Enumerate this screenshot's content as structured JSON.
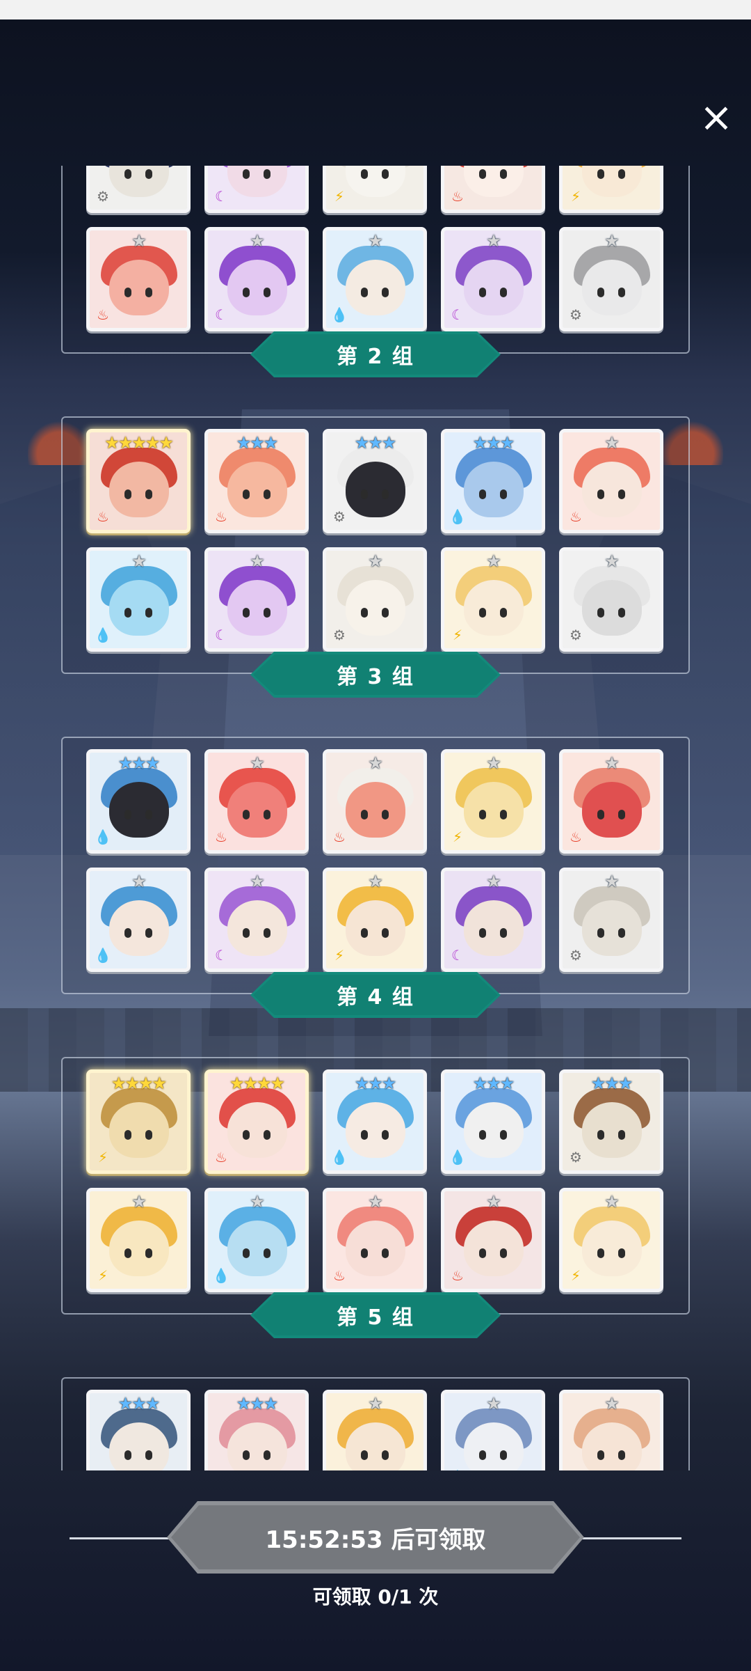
{
  "close_icon": "×",
  "groups": [
    {
      "label": "",
      "heroes": [
        {
          "stars": "★★★",
          "tier": "blue",
          "element": "neutral",
          "palette": [
            "#f0f0ee",
            "#2f3a66",
            "#e8e4dc"
          ]
        },
        {
          "stars": "★★★",
          "tier": "blue",
          "element": "shadow",
          "palette": [
            "#efe6f7",
            "#a35fd6",
            "#f1dbe7"
          ]
        },
        {
          "stars": "★★★",
          "tier": "blue",
          "element": "light",
          "palette": [
            "#f2efe8",
            "#e5e1d8",
            "#f6f4ef"
          ]
        },
        {
          "stars": "★★★",
          "tier": "blue",
          "element": "fire",
          "palette": [
            "#f6e8e2",
            "#d7463c",
            "#fbefe8"
          ]
        },
        {
          "stars": "★★★",
          "tier": "blue",
          "element": "light",
          "palette": [
            "#f8efdd",
            "#f0b341",
            "#f8e9d6"
          ]
        },
        {
          "stars": "★",
          "tier": "gray",
          "element": "fire",
          "palette": [
            "#f8e3e1",
            "#e1574e",
            "#f4b0a2"
          ]
        },
        {
          "stars": "★",
          "tier": "gray",
          "element": "shadow",
          "palette": [
            "#ede3f6",
            "#8f4fcf",
            "#e3c8f2"
          ]
        },
        {
          "stars": "★",
          "tier": "gray",
          "element": "water",
          "palette": [
            "#e2f0fb",
            "#6fb6e4",
            "#f4ebe2"
          ]
        },
        {
          "stars": "★",
          "tier": "gray",
          "element": "shadow",
          "palette": [
            "#ece3f6",
            "#8d58cc",
            "#e5d5f2"
          ]
        },
        {
          "stars": "★",
          "tier": "gray",
          "element": "neutral",
          "palette": [
            "#eeeeee",
            "#a7a7a9",
            "#e9e9ea"
          ]
        }
      ],
      "tag": "第 2 组"
    },
    {
      "heroes": [
        {
          "stars": "★★★★★",
          "tier": "gold",
          "element": "fire",
          "palette": [
            "#f6ded6",
            "#d14738",
            "#f2b8a3"
          ],
          "gold": true
        },
        {
          "stars": "★★★",
          "tier": "blue",
          "element": "fire",
          "palette": [
            "#fbe6de",
            "#ef8a6d",
            "#f6b89f"
          ]
        },
        {
          "stars": "★★★",
          "tier": "blue",
          "element": "neutral",
          "palette": [
            "#f1f1f1",
            "#ececec",
            "#2b2b32"
          ]
        },
        {
          "stars": "★★★",
          "tier": "blue",
          "element": "water",
          "palette": [
            "#e1eefc",
            "#5d97d9",
            "#a9c9ec"
          ]
        },
        {
          "stars": "★",
          "tier": "gray",
          "element": "fire",
          "palette": [
            "#fbe6e0",
            "#ee7b66",
            "#f7e6dc"
          ]
        },
        {
          "stars": "★",
          "tier": "gray",
          "element": "water",
          "palette": [
            "#e0f1fb",
            "#56aee0",
            "#a5dbf3"
          ]
        },
        {
          "stars": "★",
          "tier": "gray",
          "element": "shadow",
          "palette": [
            "#ede3f6",
            "#8f4fcf",
            "#e3c8f2"
          ]
        },
        {
          "stars": "★",
          "tier": "gray",
          "element": "neutral",
          "palette": [
            "#f2efea",
            "#e7e1d6",
            "#f7f2ea"
          ]
        },
        {
          "stars": "★",
          "tier": "gray",
          "element": "light",
          "palette": [
            "#fbf3df",
            "#f3ce7a",
            "#f8ebd8"
          ]
        },
        {
          "stars": "★",
          "tier": "gray",
          "element": "neutral",
          "palette": [
            "#f1f1f1",
            "#e6e6e6",
            "#dcdcdc"
          ]
        }
      ],
      "tag": "第 3 组"
    },
    {
      "heroes": [
        {
          "stars": "★★★",
          "tier": "blue",
          "element": "water",
          "palette": [
            "#e3eef8",
            "#4a8fce",
            "#2b2b32"
          ]
        },
        {
          "stars": "★",
          "tier": "gray",
          "element": "fire",
          "palette": [
            "#fbe1df",
            "#e8554e",
            "#f0807a"
          ]
        },
        {
          "stars": "★",
          "tier": "gray",
          "element": "fire",
          "palette": [
            "#f6ebe6",
            "#f2efea",
            "#f19784"
          ]
        },
        {
          "stars": "★",
          "tier": "gray",
          "element": "light",
          "palette": [
            "#fbf3dd",
            "#f0c75d",
            "#f6e1a8"
          ]
        },
        {
          "stars": "★",
          "tier": "gray",
          "element": "fire",
          "palette": [
            "#fbe6df",
            "#eb8a78",
            "#e05050"
          ]
        },
        {
          "stars": "★",
          "tier": "gray",
          "element": "water",
          "palette": [
            "#e5eff9",
            "#4e9bd6",
            "#f4e6dc"
          ]
        },
        {
          "stars": "★",
          "tier": "gray",
          "element": "shadow",
          "palette": [
            "#efe4f6",
            "#a66bd8",
            "#f4e6dc"
          ]
        },
        {
          "stars": "★",
          "tier": "gray",
          "element": "light",
          "palette": [
            "#fbf2dc",
            "#f2bd48",
            "#f6e5d4"
          ]
        },
        {
          "stars": "★",
          "tier": "gray",
          "element": "shadow",
          "palette": [
            "#ebe2f4",
            "#8a55c9",
            "#f1e3da"
          ]
        },
        {
          "stars": "★",
          "tier": "gray",
          "element": "neutral",
          "palette": [
            "#efefef",
            "#cfcac0",
            "#e6e1d8"
          ]
        }
      ],
      "tag": "第 4 组"
    },
    {
      "heroes": [
        {
          "stars": "★★★★",
          "tier": "gold",
          "element": "light",
          "palette": [
            "#f4e6c6",
            "#c59a4c",
            "#f0dcae"
          ],
          "gold": true
        },
        {
          "stars": "★★★★",
          "tier": "gold",
          "element": "fire",
          "palette": [
            "#fbe3df",
            "#e2504a",
            "#f7e2d8"
          ],
          "gold": true
        },
        {
          "stars": "★★★",
          "tier": "blue",
          "element": "water",
          "palette": [
            "#e2f0fb",
            "#5eb2e6",
            "#f6ebe3"
          ]
        },
        {
          "stars": "★★★",
          "tier": "blue",
          "element": "water",
          "palette": [
            "#e1eefc",
            "#6aa3e0",
            "#f0f0f0"
          ]
        },
        {
          "stars": "★★★",
          "tier": "blue",
          "element": "neutral",
          "palette": [
            "#f1ece3",
            "#9b6b47",
            "#e8dfcf"
          ]
        },
        {
          "stars": "★",
          "tier": "gray",
          "element": "light",
          "palette": [
            "#fbf0d6",
            "#f0b947",
            "#f8e7c0"
          ]
        },
        {
          "stars": "★",
          "tier": "gray",
          "element": "water",
          "palette": [
            "#e0f0fb",
            "#5bb0e5",
            "#b7def2"
          ]
        },
        {
          "stars": "★",
          "tier": "gray",
          "element": "fire",
          "palette": [
            "#fbe6e2",
            "#f08a80",
            "#f7ded7"
          ]
        },
        {
          "stars": "★",
          "tier": "gray",
          "element": "fire",
          "palette": [
            "#f4e5e5",
            "#c9403a",
            "#f4e3d9"
          ]
        },
        {
          "stars": "★",
          "tier": "gray",
          "element": "light",
          "palette": [
            "#fbf3df",
            "#f3ce7a",
            "#f8ebd8"
          ]
        }
      ],
      "tag": "第 5 组"
    },
    {
      "heroes": [
        {
          "stars": "★★★",
          "tier": "blue",
          "element": "neutral",
          "palette": [
            "#e8eef4",
            "#4e6a8c",
            "#f0e8e0"
          ]
        },
        {
          "stars": "★★★",
          "tier": "blue",
          "element": "fire",
          "palette": [
            "#f6e6e6",
            "#e49aa3",
            "#f5e4dc"
          ]
        },
        {
          "stars": "★",
          "tier": "gray",
          "element": "light",
          "palette": [
            "#fbf1dc",
            "#f0b64a",
            "#f6e6d4"
          ]
        },
        {
          "stars": "★",
          "tier": "gray",
          "element": "water",
          "palette": [
            "#e7eef8",
            "#7d97c4",
            "#eef0f4"
          ]
        },
        {
          "stars": "★",
          "tier": "gray",
          "element": "fire",
          "palette": [
            "#f8ebe2",
            "#e6b08e",
            "#f6e4d6"
          ]
        }
      ],
      "tag": ""
    }
  ],
  "claim_button": "15:52:53 后可领取",
  "claim_count": "可领取 0/1 次"
}
